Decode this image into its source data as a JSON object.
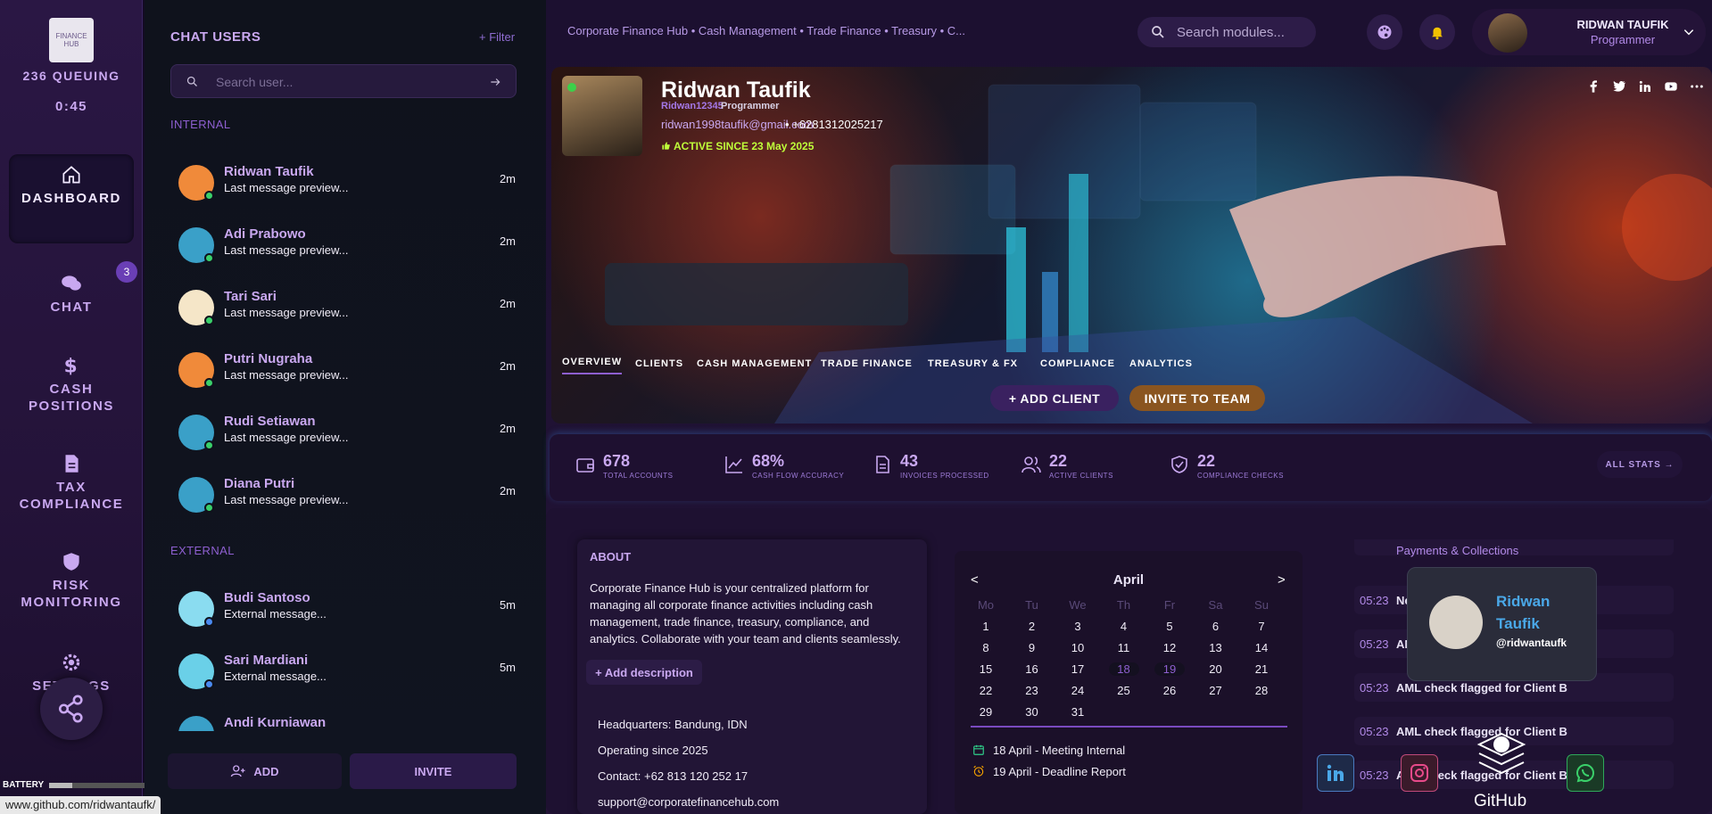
{
  "rail": {
    "logo_text": "FINANCE HUB",
    "queue": "236 QUEUING",
    "timer": "0:45",
    "items": [
      {
        "label": "DASHBOARD",
        "icon": "home-icon"
      },
      {
        "label": "CHAT",
        "icon": "chat-icon"
      },
      {
        "label": "CASH POSITIONS",
        "icon": "dollar-icon"
      },
      {
        "label": "TAX COMPLIANCE",
        "icon": "document-icon"
      },
      {
        "label": "RISK MONITORING",
        "icon": "shield-icon"
      },
      {
        "label": "SETTINGS",
        "icon": "gear-icon"
      }
    ],
    "chat_badge": "3",
    "battery_label": "BATTERY"
  },
  "status_url": "www.github.com/ridwantaufk/",
  "chat": {
    "title": "CHAT USERS",
    "filter": "+ Filter",
    "search_placeholder": "Search user...",
    "internal_label": "INTERNAL",
    "external_label": "EXTERNAL",
    "internal": [
      {
        "name": "Ridwan Taufik",
        "msg": "Last message preview...",
        "time": "2m"
      },
      {
        "name": "Adi Prabowo",
        "msg": "Last message preview...",
        "time": "2m"
      },
      {
        "name": "Tari Sari",
        "msg": "Last message preview...",
        "time": "2m"
      },
      {
        "name": "Putri Nugraha",
        "msg": "Last message preview...",
        "time": "2m"
      },
      {
        "name": "Rudi Setiawan",
        "msg": "Last message preview...",
        "time": "2m"
      },
      {
        "name": "Diana Putri",
        "msg": "Last message preview...",
        "time": "2m"
      }
    ],
    "external": [
      {
        "name": "Budi Santoso",
        "msg": "External message...",
        "time": "5m"
      },
      {
        "name": "Sari Mardiani",
        "msg": "External message...",
        "time": "5m"
      },
      {
        "name": "Andi Kurniawan",
        "msg": "",
        "time": ""
      }
    ],
    "add_label": "ADD",
    "invite_label": "INVITE"
  },
  "topbar": {
    "breadcrumbs": "Corporate Finance Hub • Cash Management • Trade Finance • Treasury • C...",
    "search_placeholder": "Search modules...",
    "user_name": "RIDWAN TAUFIK",
    "user_role": "Programmer"
  },
  "hero": {
    "name": "Ridwan Taufik",
    "username": "Ridwan12345",
    "role": "Programmer",
    "email": "ridwan1998taufik@gmail.com",
    "phone": "• +6281312025217",
    "active": "ACTIVE SINCE 23 May 2025",
    "tabs": [
      "OVERVIEW",
      "CLIENTS",
      "CASH MANAGEMENT",
      "TRADE FINANCE",
      "TREASURY & FX",
      "COMPLIANCE",
      "ANALYTICS"
    ],
    "add_client": "+ ADD CLIENT",
    "invite": "INVITE TO TEAM"
  },
  "stats": {
    "items": [
      {
        "value": "678",
        "label": "TOTAL ACCOUNTS"
      },
      {
        "value": "68%",
        "label": "CASH FLOW ACCURACY"
      },
      {
        "value": "43",
        "label": "INVOICES PROCESSED"
      },
      {
        "value": "22",
        "label": "ACTIVE CLIENTS"
      },
      {
        "value": "22",
        "label": "COMPLIANCE CHECKS"
      }
    ],
    "all_label": "ALL STATS →"
  },
  "about": {
    "title": "ABOUT",
    "text": "Corporate Finance Hub is your centralized platform for managing all corporate finance activities including cash management, trade finance, treasury, compliance, and analytics. Collaborate with your team and clients seamlessly.",
    "add_desc": "+ Add description",
    "hq": "Headquarters: Bandung, IDN",
    "since": "Operating since 2025",
    "contact": "Contact: +62 813 120 252 17",
    "support": "support@corporatefinancehub.com"
  },
  "calendar": {
    "month": "April",
    "prev": "<",
    "next": ">",
    "days": [
      "Mo",
      "Tu",
      "We",
      "Th",
      "Fr",
      "Sa",
      "Su"
    ],
    "dates": [
      [
        "1",
        "2",
        "3",
        "4",
        "5",
        "6",
        "7"
      ],
      [
        "8",
        "9",
        "10",
        "11",
        "12",
        "13",
        "14"
      ],
      [
        "15",
        "16",
        "17",
        "18",
        "19",
        "20",
        "21"
      ],
      [
        "22",
        "23",
        "24",
        "25",
        "26",
        "27",
        "28"
      ],
      [
        "29",
        "30",
        "31",
        "",
        "",
        "",
        ""
      ]
    ],
    "events": [
      "18 April - Meeting Internal",
      "19 April - Deadline Report"
    ]
  },
  "feed": {
    "top_item": "Payments & Collections",
    "items": [
      {
        "time": "05:23",
        "msg": "New"
      },
      {
        "time": "05:23",
        "msg": "AML"
      },
      {
        "time": "05:23",
        "msg": "AML check flagged for Client B"
      },
      {
        "time": "05:23",
        "msg": "AML check flagged for Client B"
      },
      {
        "time": "05:23",
        "msg": "AML check flagged for Client B"
      }
    ]
  },
  "card": {
    "name": "Ridwan Taufik",
    "handle": "@ridwantaufk"
  },
  "github_label": "GitHub"
}
